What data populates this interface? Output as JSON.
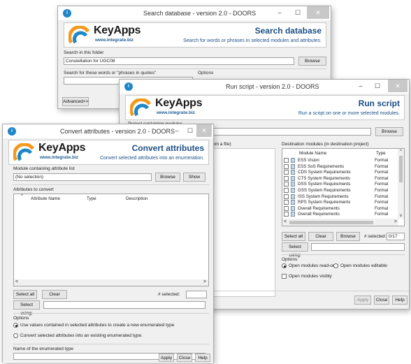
{
  "search_window": {
    "title": "Search database - version 2.0 - DOORS",
    "brand": "KeyApps",
    "brand_url": "www.integrate.biz",
    "header_title": "Search database",
    "header_subtitle": "Search for words or phrases in selected modules and attributes.",
    "folder_label": "Search in this folder",
    "folder_value": "Constellation for UGC08",
    "browse_label": "Browse",
    "words_label": "Search for these words or \"phrases in quotes\"",
    "options_label": "Options",
    "advanced_label": "Advanced>>"
  },
  "run_window": {
    "title": "Run script - version 2.0 - DOORS",
    "brand": "KeyApps",
    "brand_url": "www.integrate.biz",
    "header_title": "Run script",
    "header_subtitle": "Run a script on one or more selected modules.",
    "project_label": "Project containing modules",
    "browse_label": "Browse",
    "from_file_label": "om a file)",
    "dest_label": "Destination modules (in destination project)",
    "dest_columns": [
      "Module Name",
      "Type"
    ],
    "dest_rows": [
      {
        "name": "ESS Vision",
        "type": "Formal"
      },
      {
        "name": "ESS SoS Requirements",
        "type": "Formal"
      },
      {
        "name": "CDS System Requirements",
        "type": "Formal"
      },
      {
        "name": "CTS System Requirements",
        "type": "Formal"
      },
      {
        "name": "DSS System Requirements",
        "type": "Formal"
      },
      {
        "name": "GSS System Requirements",
        "type": "Formal"
      },
      {
        "name": "ISS System Requirements",
        "type": "Formal"
      },
      {
        "name": "RPS System Requirements",
        "type": "Formal"
      },
      {
        "name": "Overall Requirements",
        "type": "Formal"
      },
      {
        "name": "Overall Requirements",
        "type": "Formal"
      }
    ],
    "select_all_label": "Select all",
    "clear_label": "Clear",
    "browse2_label": "Browse",
    "selected_label": "# selected:",
    "selected_value": "0/17",
    "select_using_label": "Select using:",
    "options_label": "Options",
    "readonly_label": "Open modules read-only",
    "editable_label": "Open modules editable",
    "visibly_label": "Open modules visibly",
    "apply_label": "Apply",
    "close_label": "Close",
    "help_label": "Help"
  },
  "convert_window": {
    "title": "Convert attributes - version 2.0 - DOORS",
    "brand": "KeyApps",
    "brand_url": "www.integrate.biz",
    "header_title": "Convert attributes",
    "header_subtitle": "Convert selected attributes into an enumeration.",
    "module_label": "Module containing attribute list",
    "module_value": "(No selection)",
    "browse_label": "Browse",
    "show_label": "Show",
    "attributes_label": "Attributes to convert",
    "columns": [
      "Attribute Name",
      "Type",
      "Description"
    ],
    "select_all_label": "Select all",
    "clear_label": "Clear",
    "selected_label": "# selected:",
    "select_using_label": "Select using:",
    "options_label": "Options",
    "option1": "Use values contained in selected attributes to create a new enumerated type",
    "option2": "Convert selected attributes into an existing enumerated type.",
    "enum_name_label": "Name of the enumerated type",
    "apply_label": "Apply",
    "close_label": "Close",
    "help_label": "Help"
  },
  "colors": {
    "brand_blue": "#1c4f86",
    "logo_blue": "#1f86c8",
    "logo_orange": "#f39a1e"
  }
}
